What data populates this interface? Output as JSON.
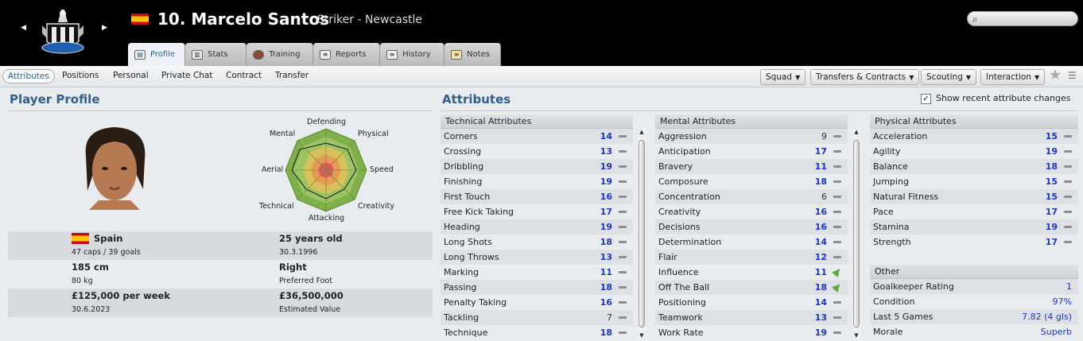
{
  "header": {
    "player_number_name": "10. Marcelo Santos",
    "role_club": "Striker - Newcastle",
    "nationality_flag": "spain-flag",
    "club_crest": "newcastle-crest"
  },
  "tabs": [
    {
      "label": "Profile",
      "icon": "profile-icon",
      "active": true
    },
    {
      "label": "Stats",
      "icon": "stats-icon"
    },
    {
      "label": "Training",
      "icon": "training-icon"
    },
    {
      "label": "Reports",
      "icon": "reports-icon"
    },
    {
      "label": "History",
      "icon": "history-icon"
    },
    {
      "label": "Notes",
      "icon": "notes-icon"
    }
  ],
  "subnav": {
    "items": [
      "Attributes",
      "Positions",
      "Personal",
      "Private Chat",
      "Contract",
      "Transfer"
    ],
    "active": "Attributes",
    "menus": [
      "Squad",
      "Transfers & Contracts",
      "Scouting",
      "Interaction"
    ]
  },
  "profile": {
    "title": "Player Profile",
    "radar_labels": {
      "top": "Defending",
      "top_right": "Physical",
      "right": "Speed",
      "bottom_right": "Creativity",
      "bottom": "Attacking",
      "bottom_left": "Technical",
      "left": "Aerial",
      "top_left": "Mental"
    },
    "nation": "Spain",
    "caps_goals": "47 caps / 39 goals",
    "age": "25 years old",
    "dob": "30.3.1996",
    "height": "185 cm",
    "weight": "80 kg",
    "foot": "Right",
    "foot_label": "Preferred Foot",
    "wage": "£125,000 per week",
    "contract_end": "30.6.2023",
    "value": "£36,500,000",
    "value_label": "Estimated Value"
  },
  "attributes": {
    "title": "Attributes",
    "show_changes_label": "Show recent attribute changes",
    "show_changes_checked": true,
    "technical_header": "Technical Attributes",
    "mental_header": "Mental Attributes",
    "physical_header": "Physical Attributes",
    "other_header": "Other",
    "technical": [
      {
        "name": "Corners",
        "value": "14",
        "trend": "flat"
      },
      {
        "name": "Crossing",
        "value": "13",
        "trend": "flat"
      },
      {
        "name": "Dribbling",
        "value": "19",
        "trend": "flat"
      },
      {
        "name": "Finishing",
        "value": "19",
        "trend": "flat"
      },
      {
        "name": "First Touch",
        "value": "16",
        "trend": "flat"
      },
      {
        "name": "Free Kick Taking",
        "value": "17",
        "trend": "flat"
      },
      {
        "name": "Heading",
        "value": "19",
        "trend": "flat"
      },
      {
        "name": "Long Shots",
        "value": "18",
        "trend": "flat"
      },
      {
        "name": "Long Throws",
        "value": "13",
        "trend": "flat"
      },
      {
        "name": "Marking",
        "value": "11",
        "trend": "flat"
      },
      {
        "name": "Passing",
        "value": "18",
        "trend": "flat"
      },
      {
        "name": "Penalty Taking",
        "value": "16",
        "trend": "flat"
      },
      {
        "name": "Tackling",
        "value": "7",
        "trend": "flat"
      },
      {
        "name": "Technique",
        "value": "18",
        "trend": "flat"
      }
    ],
    "mental": [
      {
        "name": "Aggression",
        "value": "9",
        "trend": "flat"
      },
      {
        "name": "Anticipation",
        "value": "17",
        "trend": "flat"
      },
      {
        "name": "Bravery",
        "value": "11",
        "trend": "flat"
      },
      {
        "name": "Composure",
        "value": "18",
        "trend": "flat"
      },
      {
        "name": "Concentration",
        "value": "6",
        "trend": "flat"
      },
      {
        "name": "Creativity",
        "value": "16",
        "trend": "flat"
      },
      {
        "name": "Decisions",
        "value": "16",
        "trend": "flat"
      },
      {
        "name": "Determination",
        "value": "14",
        "trend": "flat"
      },
      {
        "name": "Flair",
        "value": "12",
        "trend": "flat"
      },
      {
        "name": "Influence",
        "value": "11",
        "trend": "up"
      },
      {
        "name": "Off The Ball",
        "value": "18",
        "trend": "up"
      },
      {
        "name": "Positioning",
        "value": "14",
        "trend": "flat"
      },
      {
        "name": "Teamwork",
        "value": "13",
        "trend": "flat"
      },
      {
        "name": "Work Rate",
        "value": "19",
        "trend": "flat"
      }
    ],
    "physical": [
      {
        "name": "Acceleration",
        "value": "15",
        "trend": "flat"
      },
      {
        "name": "Agility",
        "value": "19",
        "trend": "flat"
      },
      {
        "name": "Balance",
        "value": "18",
        "trend": "flat"
      },
      {
        "name": "Jumping",
        "value": "15",
        "trend": "flat"
      },
      {
        "name": "Natural Fitness",
        "value": "15",
        "trend": "flat"
      },
      {
        "name": "Pace",
        "value": "17",
        "trend": "flat"
      },
      {
        "name": "Stamina",
        "value": "19",
        "trend": "flat"
      },
      {
        "name": "Strength",
        "value": "17",
        "trend": "flat"
      }
    ],
    "other": [
      {
        "name": "Goalkeeper Rating",
        "value": "1"
      },
      {
        "name": "Condition",
        "value": "97%"
      },
      {
        "name": "Last 5 Games",
        "value": "7.82 (4 gls)"
      },
      {
        "name": "Morale",
        "value": "Superb"
      }
    ]
  },
  "colors": {
    "accent": "#2f5f8f",
    "high_value": "#1a37c8",
    "trend_up": "#5aab3a"
  }
}
